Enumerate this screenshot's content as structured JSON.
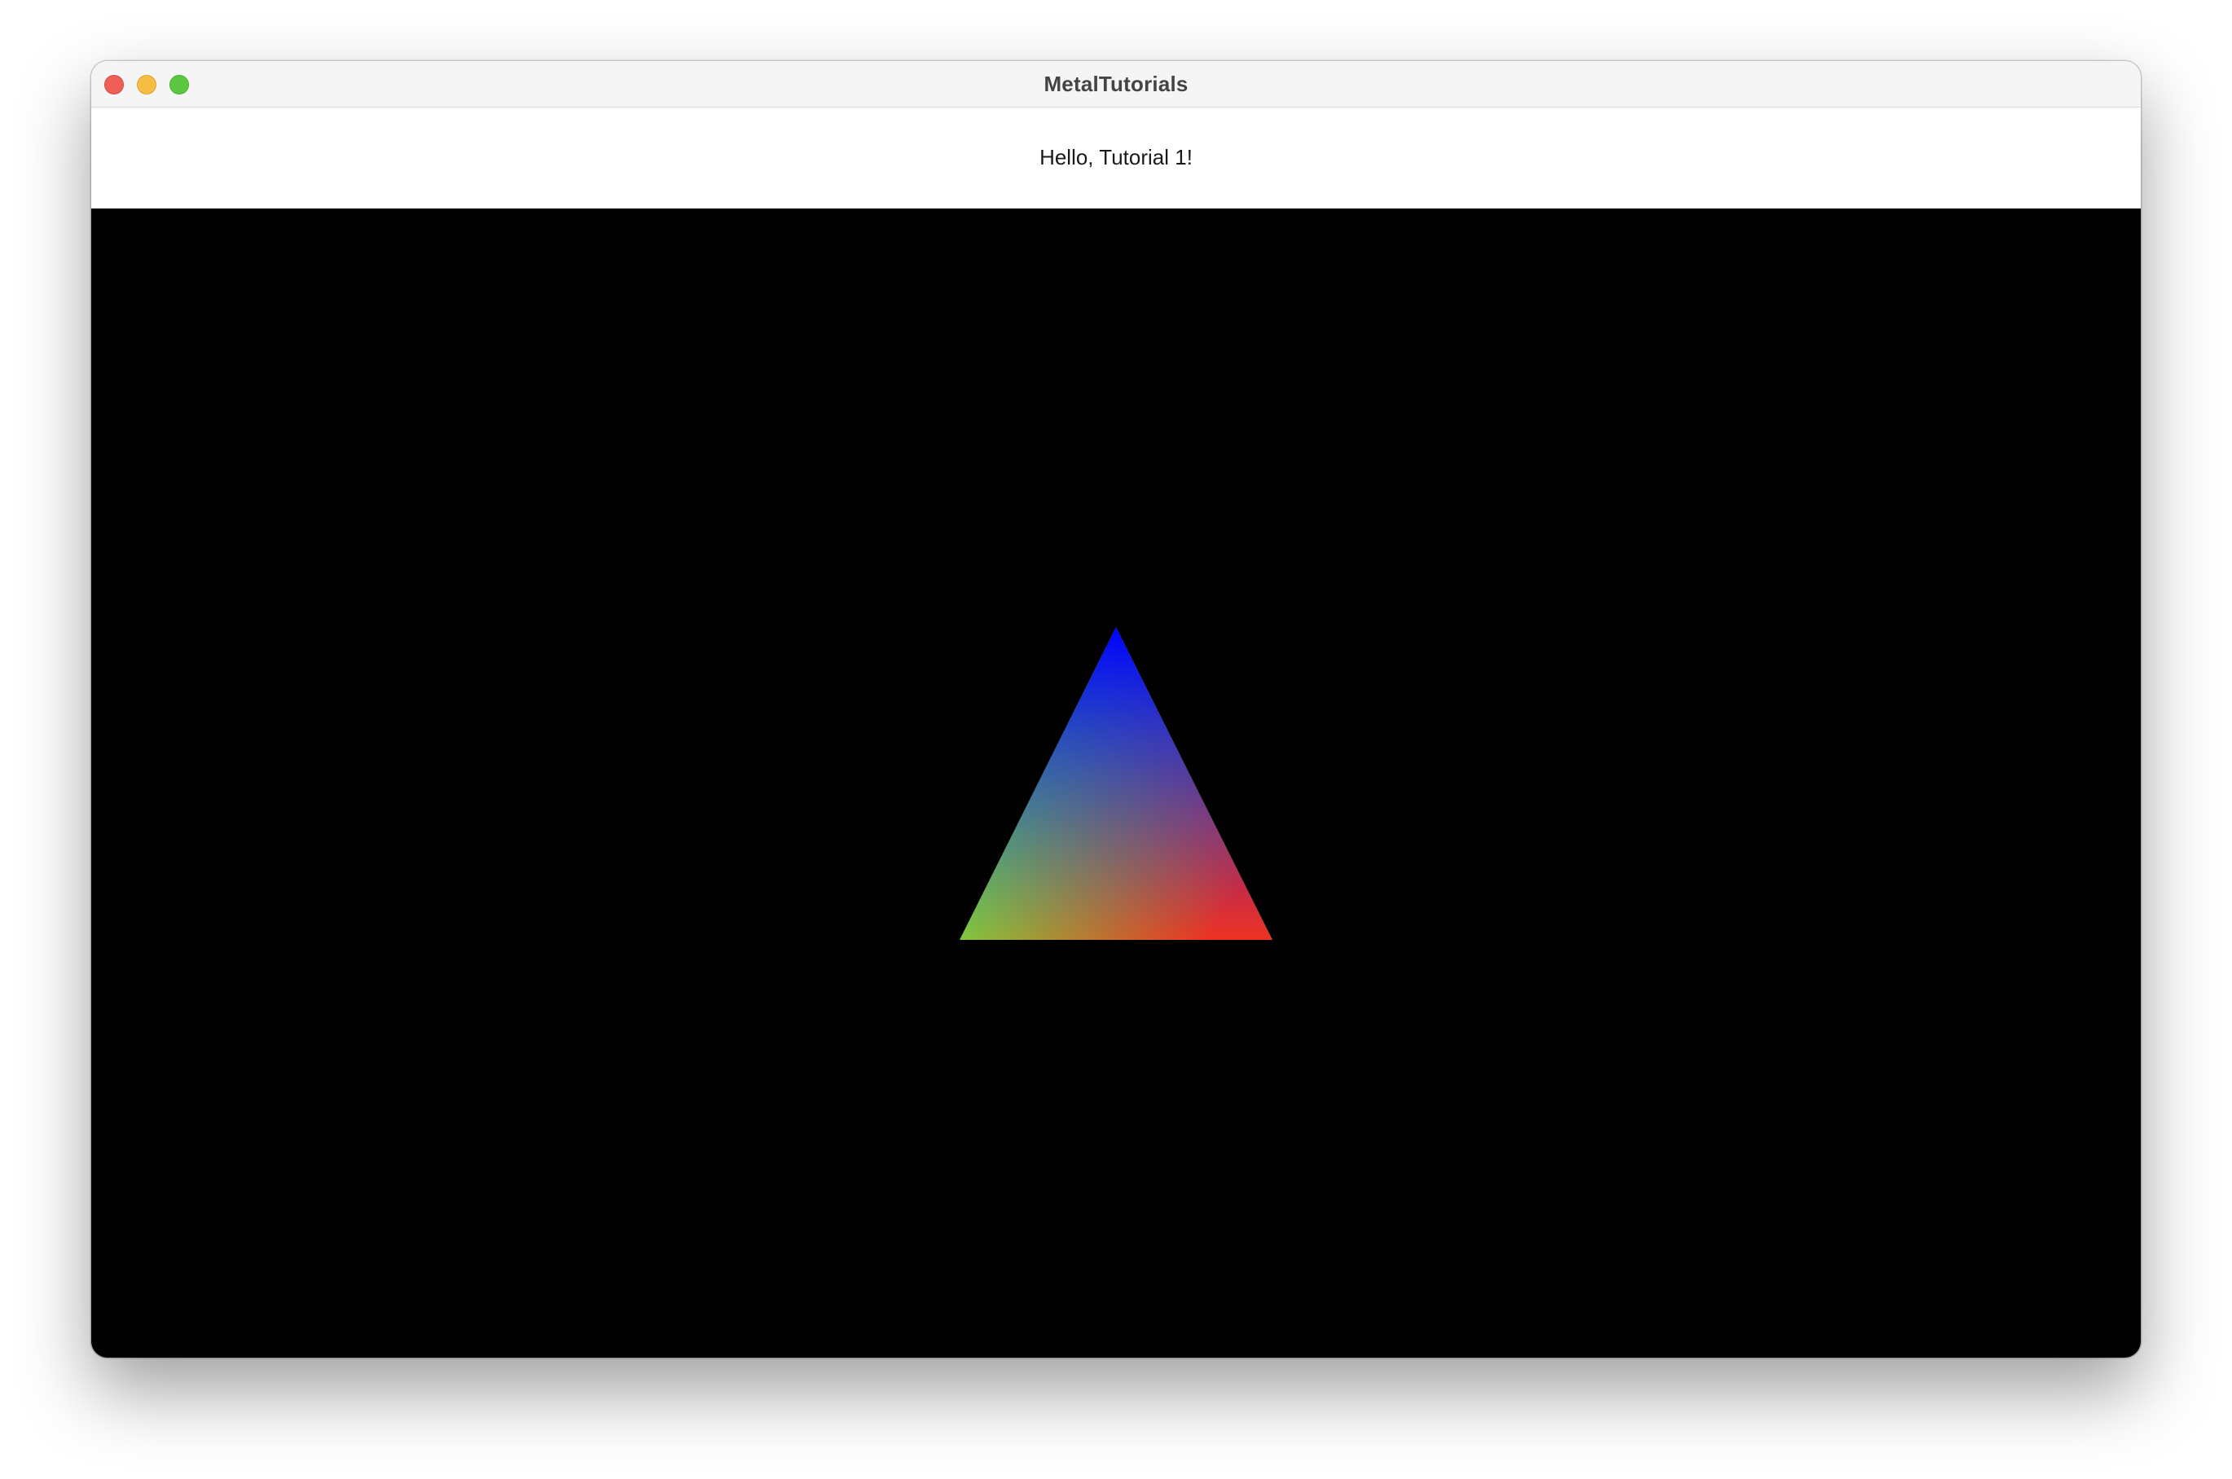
{
  "window": {
    "title": "MetalTutorials"
  },
  "controls": {
    "close": "close-button",
    "minimize": "minimize-button",
    "zoom": "zoom-button"
  },
  "content": {
    "greeting": "Hello, Tutorial 1!"
  },
  "render": {
    "background_color": "#000000",
    "triangle_vertex_colors": {
      "top": "#0000ff",
      "bottom_left": "#66ee44",
      "bottom_right": "#ee3322"
    }
  }
}
